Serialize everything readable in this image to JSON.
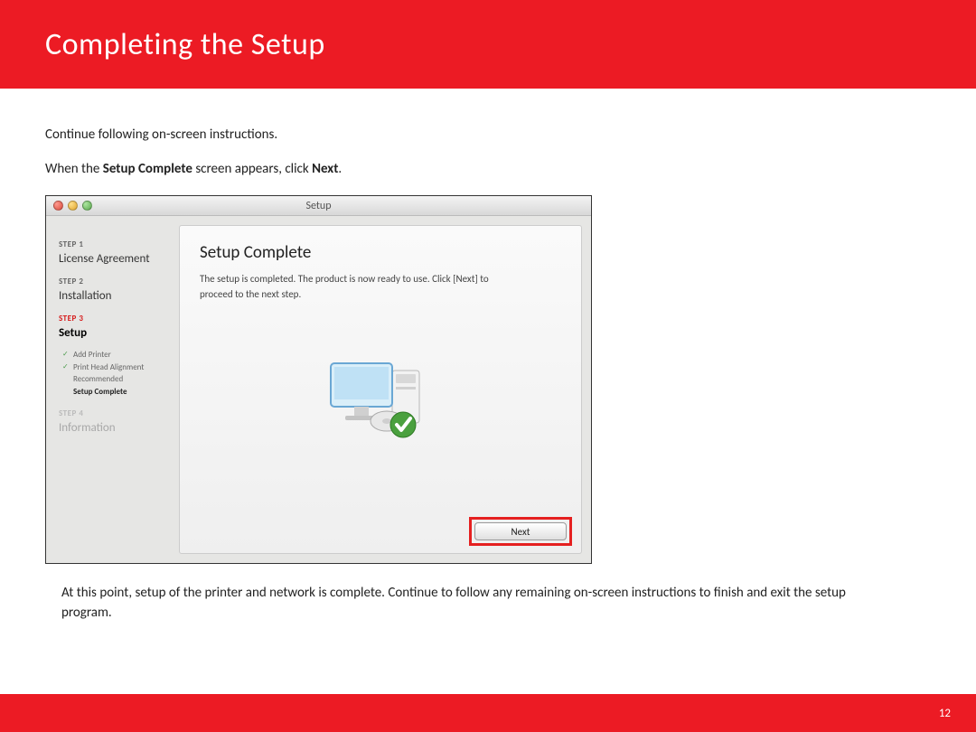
{
  "header": {
    "title": "Completing  the Setup"
  },
  "instructions": {
    "line1": "Continue following on-screen instructions.",
    "line2_pre": "When the  ",
    "line2_bold1": "Setup Complete",
    "line2_mid": " screen appears, click ",
    "line2_bold2": "Next",
    "line2_post": "."
  },
  "window": {
    "title": "Setup",
    "sidebar": {
      "step1_label": "STEP 1",
      "step1_name": "License Agreement",
      "step2_label": "STEP 2",
      "step2_name": "Installation",
      "step3_label": "STEP 3",
      "step3_name": "Setup",
      "sub1": "Add Printer",
      "sub2": "Print Head Alignment Recommended",
      "sub3": "Setup Complete",
      "step4_label": "STEP 4",
      "step4_name": "Information"
    },
    "panel": {
      "title": "Setup Complete",
      "text": "The setup is completed. The product is now ready to use. Click [Next] to proceed to the next step."
    },
    "next_label": "Next"
  },
  "conclusion": "At this point, setup of the printer and network is complete.  Continue to follow any remaining on-screen instructions to finish and exit the setup program.",
  "page_number": "12"
}
